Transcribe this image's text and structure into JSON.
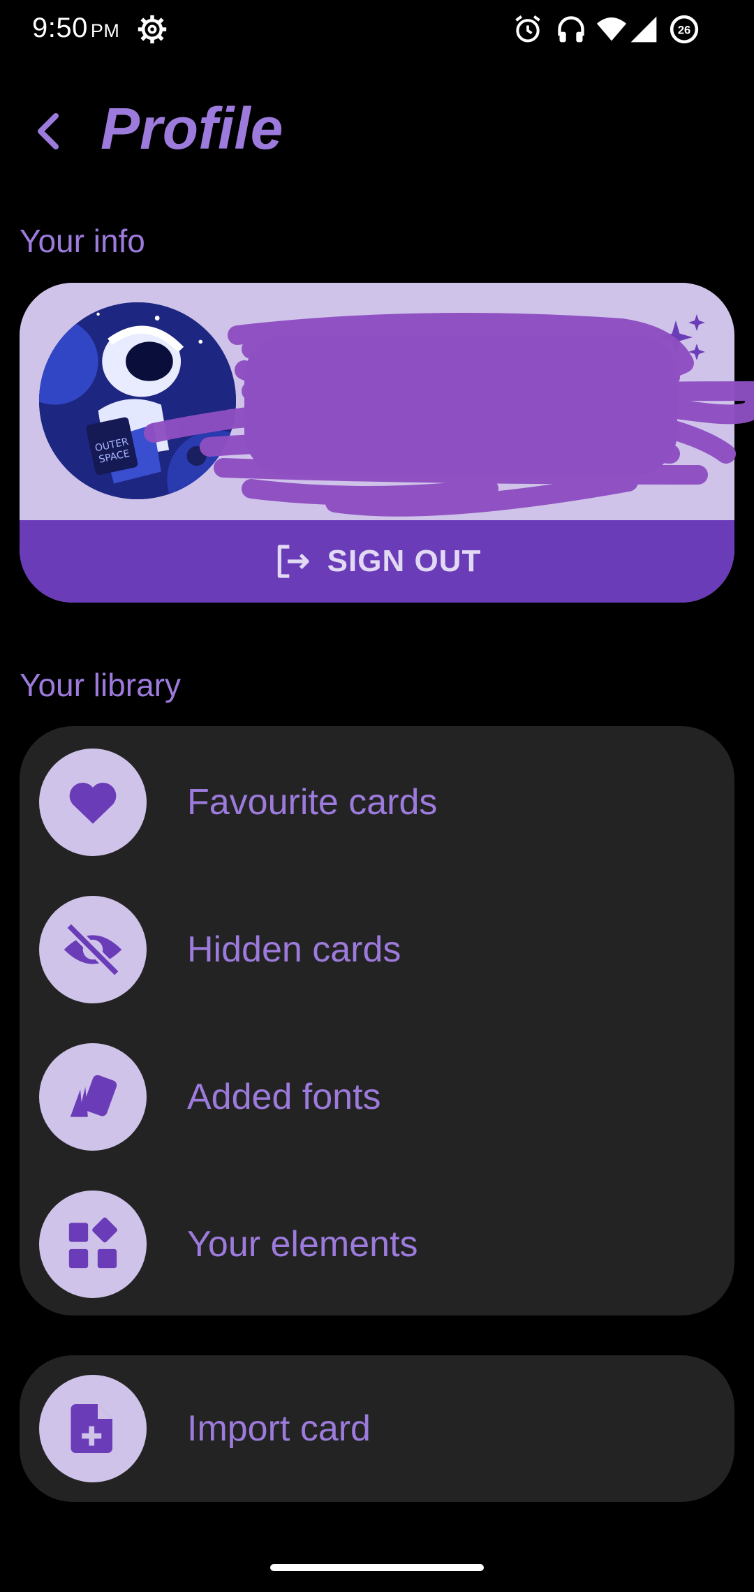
{
  "status_bar": {
    "time": "9:50",
    "ampm": "PM",
    "battery_level": "26",
    "icons": [
      "settings-gear-icon",
      "alarm-icon",
      "headphones-icon",
      "wifi-icon",
      "cell-signal-icon",
      "battery-icon"
    ]
  },
  "header": {
    "back_icon": "chevron-left-icon",
    "title": "Profile"
  },
  "info_section": {
    "label": "Your info",
    "avatar_icon": "astronaut-avatar",
    "sparkle_icon": "sparkle-icon",
    "signout_icon": "logout-icon",
    "signout_label": "SIGN OUT"
  },
  "library_section": {
    "label": "Your library",
    "items": [
      {
        "label": "Favourite cards",
        "icon": "heart-icon"
      },
      {
        "label": "Hidden cards",
        "icon": "eye-off-icon"
      },
      {
        "label": "Added fonts",
        "icon": "cards-icon"
      },
      {
        "label": "Your elements",
        "icon": "elements-grid-icon"
      }
    ]
  },
  "import": {
    "label": "Import card",
    "icon": "file-plus-icon"
  },
  "colors": {
    "background": "#000000",
    "accent": "#9d7bdc",
    "accent_dark": "#6a3cb8",
    "accent_light": "#d0c3ea",
    "card_bg": "#232323",
    "scribble": "#8e4fc2"
  }
}
